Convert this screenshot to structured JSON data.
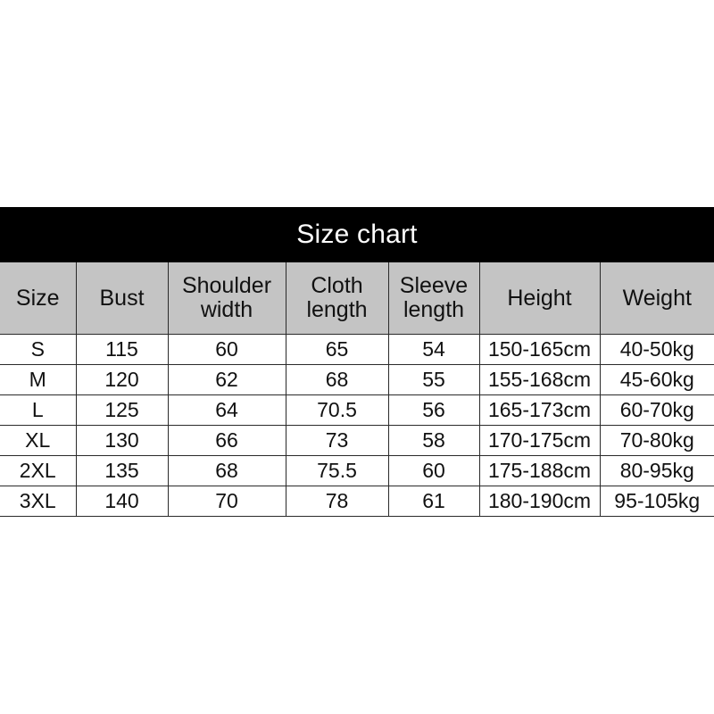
{
  "title": "Size chart",
  "colors": {
    "title_band_bg": "#000000",
    "title_text": "#ffffff",
    "header_bg": "#c4c4c4",
    "cell_bg": "#ffffff",
    "border": "#2a2a2a",
    "page_bg": "#ffffff"
  },
  "chart_data": {
    "type": "table",
    "title": "Size chart",
    "columns": [
      "Size",
      "Shoulder\nwidth",
      "Cloth\nlength",
      "Sleeve\nlength",
      "Height",
      "Weight"
    ],
    "headers": {
      "size": "Size",
      "bust": "Bust",
      "shoulder_width_line1": "Shoulder",
      "shoulder_width_line2": "width",
      "cloth_length_line1": "Cloth",
      "cloth_length_line2": "length",
      "sleeve_length_line1": "Sleeve",
      "sleeve_length_line2": "length",
      "height": "Height",
      "weight": "Weight"
    },
    "rows": [
      {
        "size": "S",
        "bust": "115",
        "shoulder_width": "60",
        "cloth_length": "65",
        "sleeve_length": "54",
        "height": "150-165cm",
        "weight": "40-50kg"
      },
      {
        "size": "M",
        "bust": "120",
        "shoulder_width": "62",
        "cloth_length": "68",
        "sleeve_length": "55",
        "height": "155-168cm",
        "weight": "45-60kg"
      },
      {
        "size": "L",
        "bust": "125",
        "shoulder_width": "64",
        "cloth_length": "70.5",
        "sleeve_length": "56",
        "height": "165-173cm",
        "weight": "60-70kg"
      },
      {
        "size": "XL",
        "bust": "130",
        "shoulder_width": "66",
        "cloth_length": "73",
        "sleeve_length": "58",
        "height": "170-175cm",
        "weight": "70-80kg"
      },
      {
        "size": "2XL",
        "bust": "135",
        "shoulder_width": "68",
        "cloth_length": "75.5",
        "sleeve_length": "60",
        "height": "175-188cm",
        "weight": "80-95kg"
      },
      {
        "size": "3XL",
        "bust": "140",
        "shoulder_width": "70",
        "cloth_length": "78",
        "sleeve_length": "61",
        "height": "180-190cm",
        "weight": "95-105kg"
      }
    ]
  }
}
